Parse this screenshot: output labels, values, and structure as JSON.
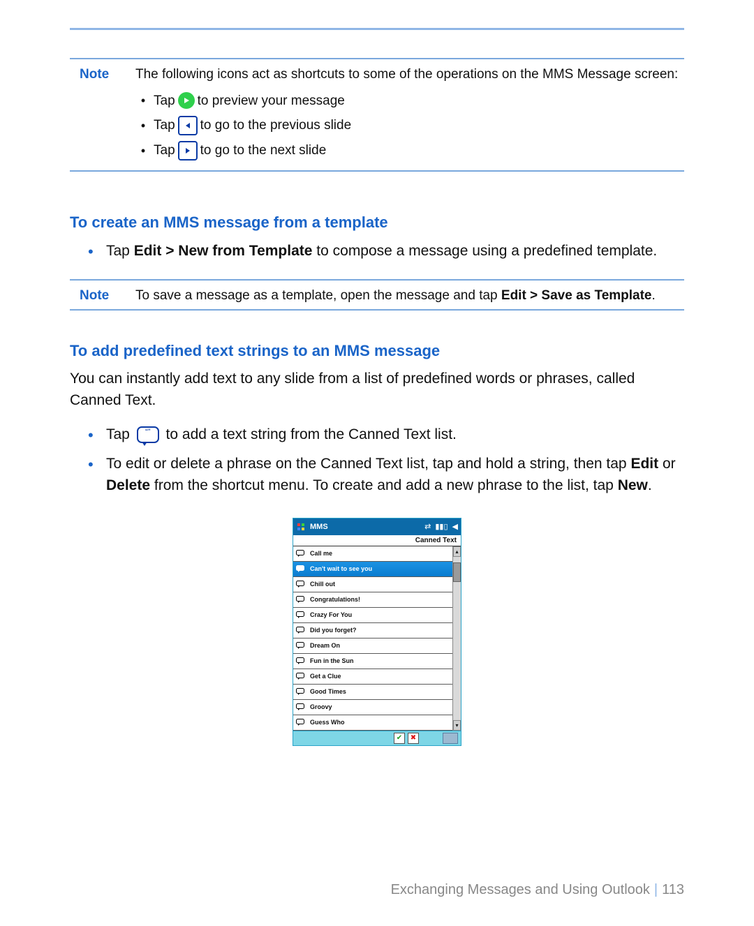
{
  "notes": {
    "note1": {
      "label": "Note",
      "intro": "The following icons act as shortcuts to some of the operations on the MMS Message screen:",
      "tap_prefix": "Tap",
      "items": [
        {
          "after": "to preview your message"
        },
        {
          "after": "to go to the previous slide"
        },
        {
          "after": "to go to the next slide"
        }
      ]
    },
    "note2": {
      "label": "Note",
      "before": "To save a message as a template, open the message and tap ",
      "bold": "Edit > Save as Template",
      "after": "."
    }
  },
  "section1": {
    "heading": "To create an MMS message from a template",
    "bullet_before": "Tap ",
    "bullet_bold": "Edit > New from Template",
    "bullet_after": " to compose a message using a predefined template."
  },
  "section2": {
    "heading": "To add predefined text strings to an MMS message",
    "intro": "You can instantly add text to any slide from a list of predefined words or phrases, called Canned Text.",
    "b1_before": "Tap ",
    "b1_after": " to add a text string from the Canned Text list.",
    "b2_p1": "To edit or delete a phrase on the Canned Text list, tap and hold a string, then tap ",
    "b2_edit": "Edit",
    "b2_or": " or ",
    "b2_delete": "Delete",
    "b2_p2": " from the shortcut menu. To create and add a new phrase to the list, tap ",
    "b2_new": "New",
    "b2_p3": "."
  },
  "screenshot": {
    "app_title": "MMS",
    "header": "Canned Text",
    "items": [
      "Call me",
      "Can't wait to see you",
      "Chill out",
      "Congratulations!",
      "Crazy For You",
      "Did you forget?",
      "Dream On",
      "Fun in the Sun",
      "Get a Clue",
      "Good Times",
      "Groovy",
      "Guess Who"
    ],
    "selected_index": 1
  },
  "footer": {
    "chapter": "Exchanging Messages and Using Outlook",
    "page": "113"
  }
}
